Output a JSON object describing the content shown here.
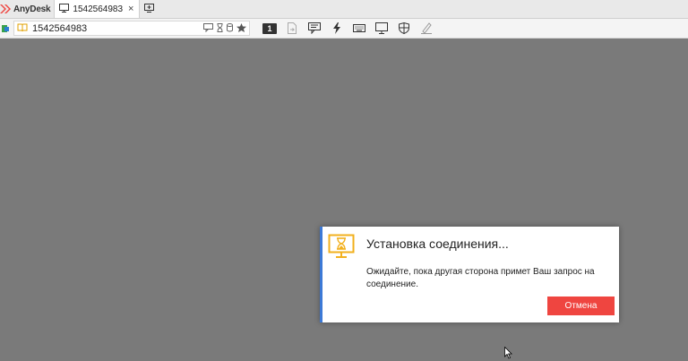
{
  "app": {
    "brand": "AnyDesk"
  },
  "tabs": [
    {
      "label": "1542564983",
      "close": "×"
    }
  ],
  "address": {
    "value": "1542564983"
  },
  "toolbar": {
    "monitor_number": "1"
  },
  "dialog": {
    "title": "Установка соединения...",
    "message": "Ожидайте, пока другая сторона примет Ваш запрос на соединение.",
    "cancel_label": "Отмена"
  },
  "colors": {
    "accent_red": "#ef4540",
    "dialog_border": "#3c79d6",
    "icon_yellow": "#f2b01e",
    "workspace": "#7a7a7a"
  },
  "icons": [
    "anydesk-logo-icon",
    "monitor-icon",
    "close-icon",
    "new-tab-icon",
    "connection-status-icon",
    "address-book-icon",
    "chat-icon",
    "history-icon",
    "storage-icon",
    "favorite-star-icon",
    "file-transfer-icon",
    "actions-lightning-icon",
    "keyboard-icon",
    "display-icon",
    "permissions-shield-icon",
    "whiteboard-pen-icon",
    "hourglass-monitor-icon",
    "mouse-cursor-icon"
  ]
}
